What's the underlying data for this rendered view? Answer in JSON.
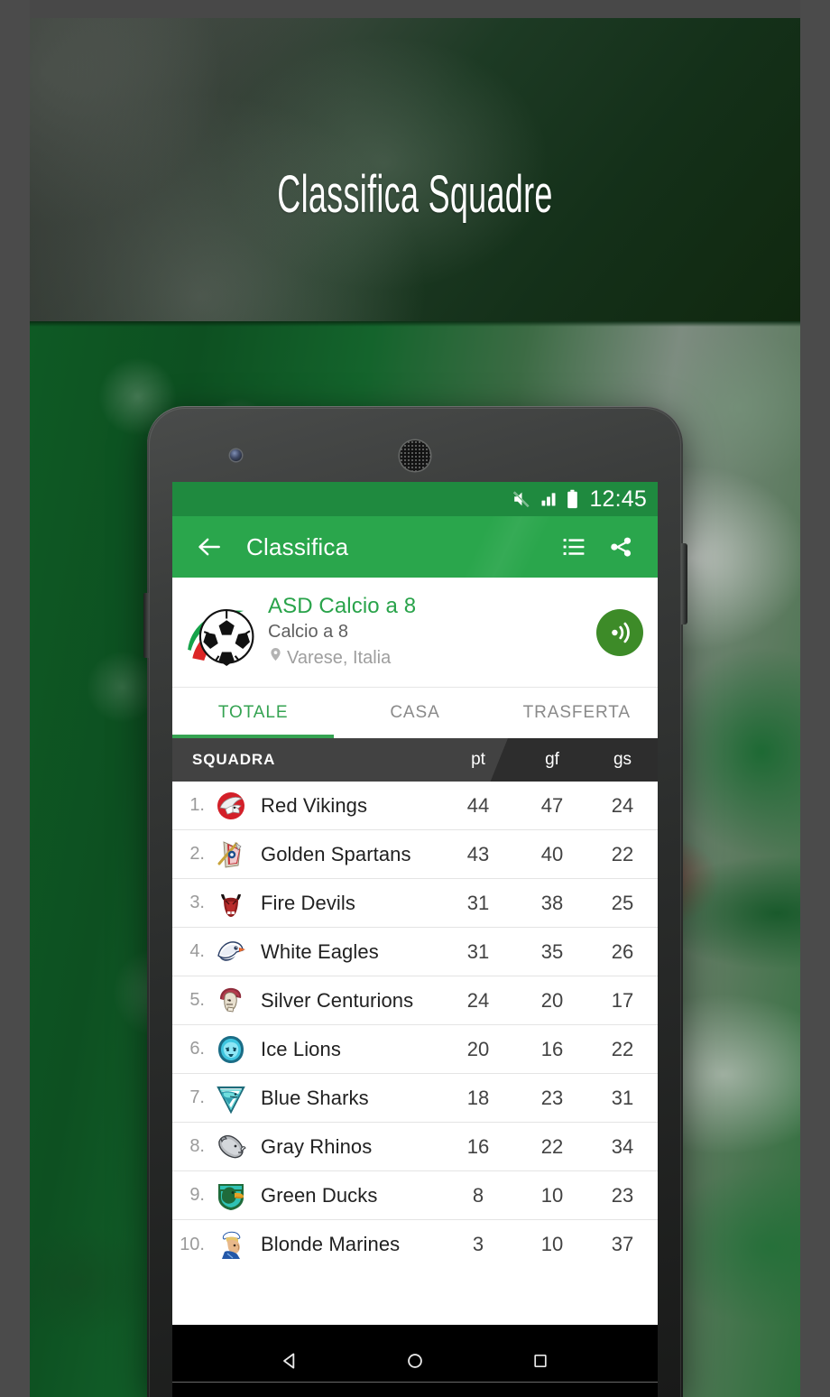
{
  "banner": {
    "title": "Classifica Squadre"
  },
  "phone": {
    "statusbar": {
      "mute_icon": "muted-speaker-icon",
      "signal_icon": "signal-bars-icon",
      "battery_icon": "battery-full-icon",
      "time": "12:45"
    },
    "appbar": {
      "back_icon": "back-arrow-icon",
      "title": "Classifica",
      "list_icon": "list-view-icon",
      "share_icon": "share-icon"
    },
    "team_header": {
      "logo_icon": "soccer-ball-italy-logo",
      "name": "ASD Calcio a 8",
      "subtitle": "Calcio a 8",
      "location_icon": "map-pin-icon",
      "location": "Varese, Italia",
      "audio_icon": "broadcast-sound-icon"
    },
    "tabs": [
      {
        "label": "TOTALE",
        "active": true
      },
      {
        "label": "CASA",
        "active": false
      },
      {
        "label": "TRASFERTA",
        "active": false
      }
    ],
    "table": {
      "headers": {
        "team": "SQUADRA",
        "pt": "pt",
        "gf": "gf",
        "gs": "gs"
      },
      "rows": [
        {
          "rank": "1.",
          "crest": "red-vikings-crest",
          "team": "Red Vikings",
          "pt": "44",
          "gf": "47",
          "gs": "24"
        },
        {
          "rank": "2.",
          "crest": "golden-spartans-crest",
          "team": "Golden Spartans",
          "pt": "43",
          "gf": "40",
          "gs": "22"
        },
        {
          "rank": "3.",
          "crest": "fire-devils-crest",
          "team": "Fire Devils",
          "pt": "31",
          "gf": "38",
          "gs": "25"
        },
        {
          "rank": "4.",
          "crest": "white-eagles-crest",
          "team": "White Eagles",
          "pt": "31",
          "gf": "35",
          "gs": "26"
        },
        {
          "rank": "5.",
          "crest": "silver-centurions-crest",
          "team": "Silver Centurions",
          "pt": "24",
          "gf": "20",
          "gs": "17"
        },
        {
          "rank": "6.",
          "crest": "ice-lions-crest",
          "team": "Ice Lions",
          "pt": "20",
          "gf": "16",
          "gs": "22"
        },
        {
          "rank": "7.",
          "crest": "blue-sharks-crest",
          "team": "Blue Sharks",
          "pt": "18",
          "gf": "23",
          "gs": "31"
        },
        {
          "rank": "8.",
          "crest": "gray-rhinos-crest",
          "team": "Gray Rhinos",
          "pt": "16",
          "gf": "22",
          "gs": "34"
        },
        {
          "rank": "9.",
          "crest": "green-ducks-crest",
          "team": "Green Ducks",
          "pt": "8",
          "gf": "10",
          "gs": "23"
        },
        {
          "rank": "10.",
          "crest": "blonde-marines-crest",
          "team": "Blonde Marines",
          "pt": "3",
          "gf": "10",
          "gs": "37"
        }
      ]
    },
    "navbar": {
      "back_icon": "android-back-icon",
      "home_icon": "android-home-icon",
      "recents_icon": "android-recents-icon"
    }
  },
  "colors": {
    "status_green": "#1f8a3f",
    "appbar_green": "#2aa64c",
    "accent_green": "#35a352",
    "team_name_green": "#29a34a",
    "audio_green": "#3d8b28",
    "table_header_dark": "#424242",
    "table_header_dark2": "#2d2d2d"
  }
}
